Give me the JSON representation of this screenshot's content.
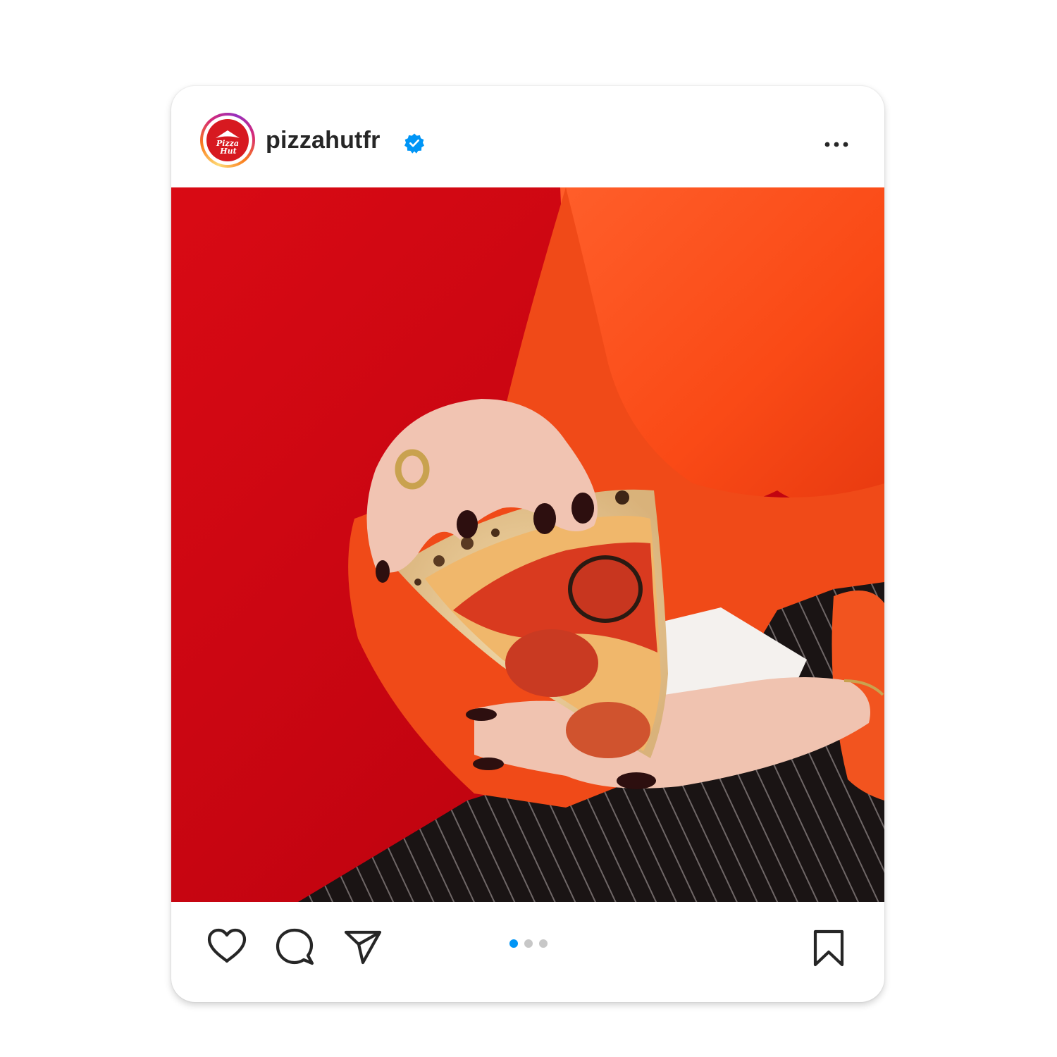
{
  "post": {
    "username": "pizzahutfr",
    "verified": true,
    "avatar": {
      "icon": "pizza-hut-logo-icon",
      "brand_color": "#d71920"
    },
    "menu_icon": "more-options-icon",
    "image": {
      "description": "hand-holding-pepperoni-pizza-slice"
    },
    "carousel": {
      "count": 3,
      "active_index": 0,
      "active_color": "#0095f6",
      "inactive_color": "#c7c7c7"
    },
    "actions": {
      "like": "heart-icon",
      "comment": "comment-icon",
      "share": "share-icon",
      "save": "bookmark-icon"
    },
    "verified_color": "#0095f6"
  }
}
